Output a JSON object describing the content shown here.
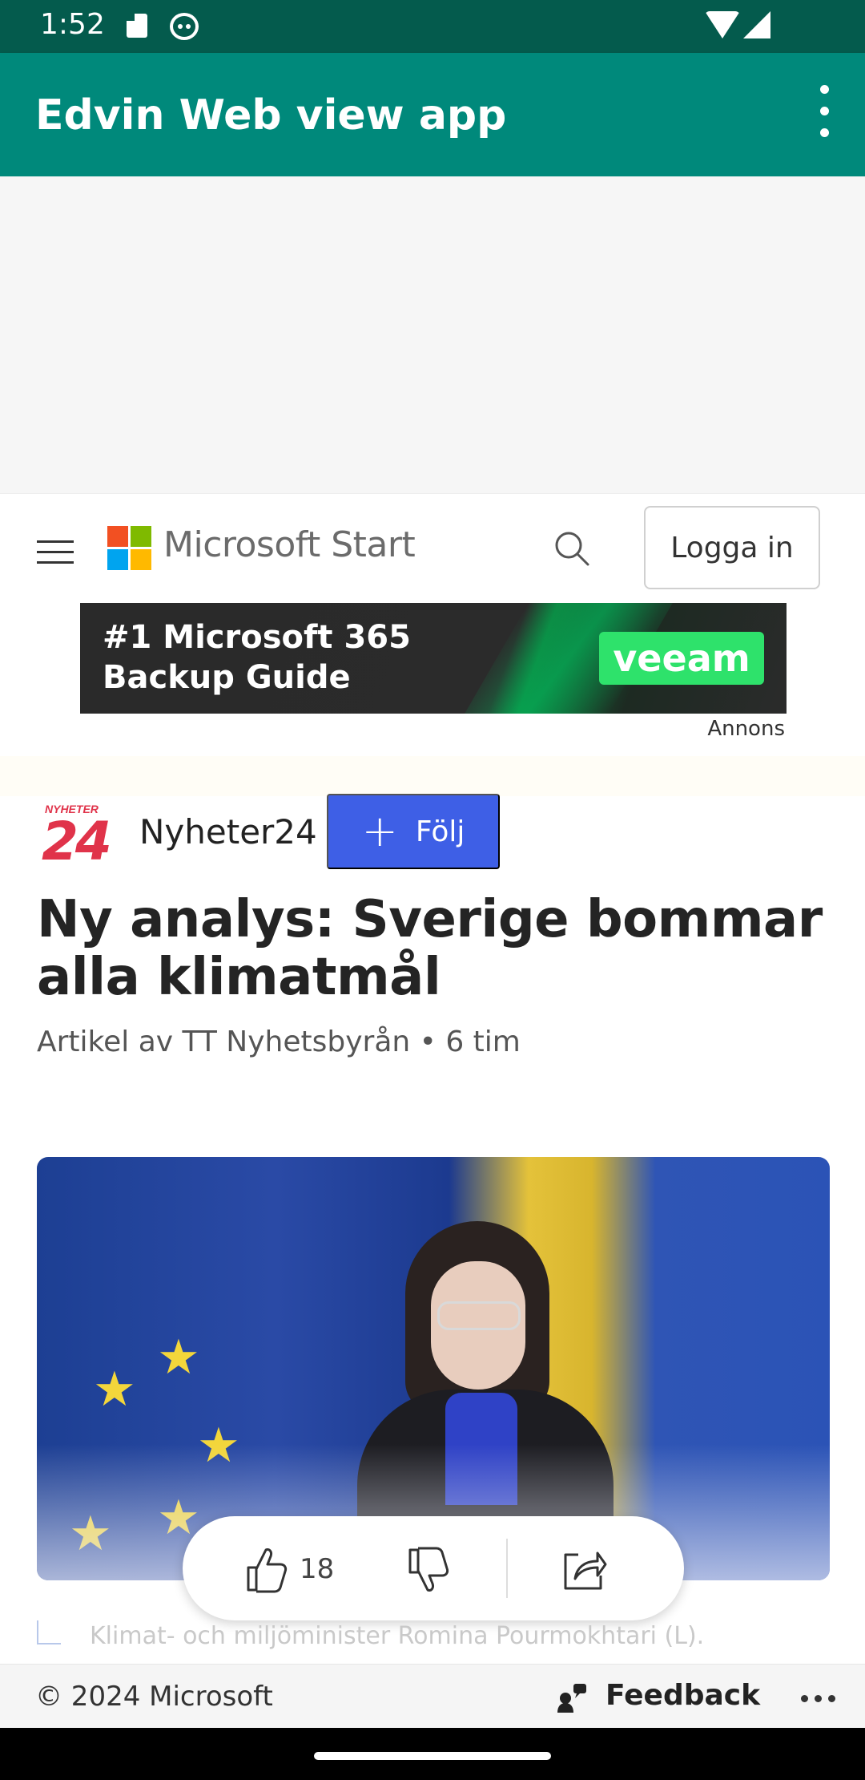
{
  "status_bar": {
    "time": "1:52"
  },
  "app_bar": {
    "title": "Edvin Web view app"
  },
  "ms_header": {
    "brand": "Microsoft Start",
    "login_label": "Logga in",
    "logo_colors": [
      "#f25022",
      "#7fba00",
      "#00a4ef",
      "#ffb900"
    ]
  },
  "ad": {
    "line1": "#1 Microsoft 365",
    "line2": "Backup Guide",
    "logo_text": "veeam",
    "label": "Annons"
  },
  "article": {
    "publisher_logo_top": "NYHETER",
    "publisher_logo_num": "24",
    "publisher": "Nyheter24",
    "follow_label": "Följ",
    "headline": "Ny analys: Sverige bommar alla klimatmål",
    "byline": "Artikel av TT Nyhetsbyrån • 6 tim",
    "like_count": "18",
    "caption": "Klimat- och miljöminister Romina Pourmokhtari (L)."
  },
  "footer": {
    "copyright": "© 2024 Microsoft",
    "feedback_label": "Feedback"
  },
  "colors": {
    "status_bar": "#045b4d",
    "app_bar": "#00897b",
    "follow_button": "#3e5fe6",
    "publisher_red": "#e0334a"
  }
}
